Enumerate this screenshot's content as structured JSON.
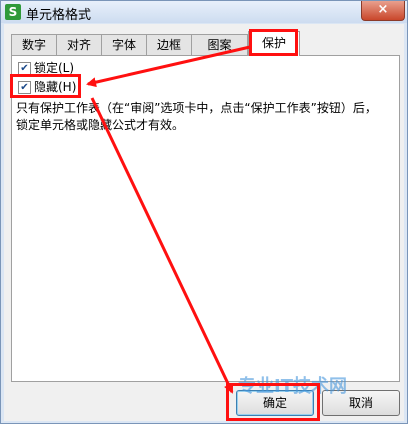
{
  "window": {
    "title": "单元格格式",
    "close_glyph": "×",
    "icon_glyph": "S"
  },
  "tabs": [
    {
      "label": "数字",
      "active": false
    },
    {
      "label": "对齐",
      "active": false
    },
    {
      "label": "字体",
      "active": false
    },
    {
      "label": "边框",
      "active": false
    },
    {
      "label": "图案",
      "active": false
    },
    {
      "label": "保护",
      "active": true
    }
  ],
  "protection": {
    "locked": {
      "label": "锁定(L)",
      "checked": true
    },
    "hidden": {
      "label": "隐藏(H)",
      "checked": true
    },
    "note": "只有保护工作表（在“审阅”选项卡中，点击“保护工作表”按钮）后，锁定单元格或隐藏公式才有效。"
  },
  "buttons": {
    "ok": "确定",
    "cancel": "取消"
  },
  "watermark": "专业IT技术网",
  "colors": {
    "annotation": "#ff1010",
    "check": "#1c4a8a"
  }
}
